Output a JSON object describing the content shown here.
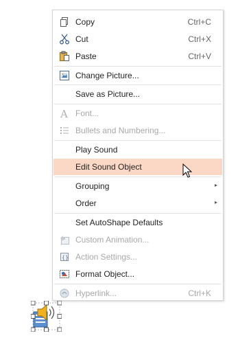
{
  "menu": {
    "items": [
      {
        "label": "Copy",
        "shortcut": "Ctrl+C",
        "icon": "copy-icon",
        "disabled": false
      },
      {
        "label": "Cut",
        "shortcut": "Ctrl+X",
        "icon": "cut-icon",
        "disabled": false
      },
      {
        "label": "Paste",
        "shortcut": "Ctrl+V",
        "icon": "paste-icon",
        "disabled": false
      },
      {
        "label": "Change Picture...",
        "icon": "change-picture-icon",
        "disabled": false
      },
      {
        "label": "Save as Picture...",
        "disabled": false
      },
      {
        "label": "Font...",
        "icon": "font-icon",
        "disabled": true
      },
      {
        "label": "Bullets and Numbering...",
        "icon": "bullets-icon",
        "disabled": true
      },
      {
        "label": "Play Sound",
        "disabled": false
      },
      {
        "label": "Edit Sound Object",
        "disabled": false,
        "highlighted": true
      },
      {
        "label": "Grouping",
        "has_submenu": true,
        "disabled": false
      },
      {
        "label": "Order",
        "has_submenu": true,
        "disabled": false
      },
      {
        "label": "Set AutoShape Defaults",
        "disabled": false
      },
      {
        "label": "Custom Animation...",
        "icon": "custom-animation-icon",
        "disabled": true
      },
      {
        "label": "Action Settings...",
        "icon": "action-settings-icon",
        "disabled": true
      },
      {
        "label": "Format Object...",
        "icon": "format-object-icon",
        "disabled": false
      },
      {
        "label": "Hyperlink...",
        "shortcut": "Ctrl+K",
        "icon": "hyperlink-icon",
        "disabled": true
      }
    ],
    "submenu_arrow": "▸"
  },
  "colors": {
    "highlight": "#fbd8c6",
    "disabled_text": "#a8a8a8",
    "text": "#222222",
    "separator": "#e2e2e2"
  },
  "selected_object": {
    "icon": "sound-object-icon"
  }
}
